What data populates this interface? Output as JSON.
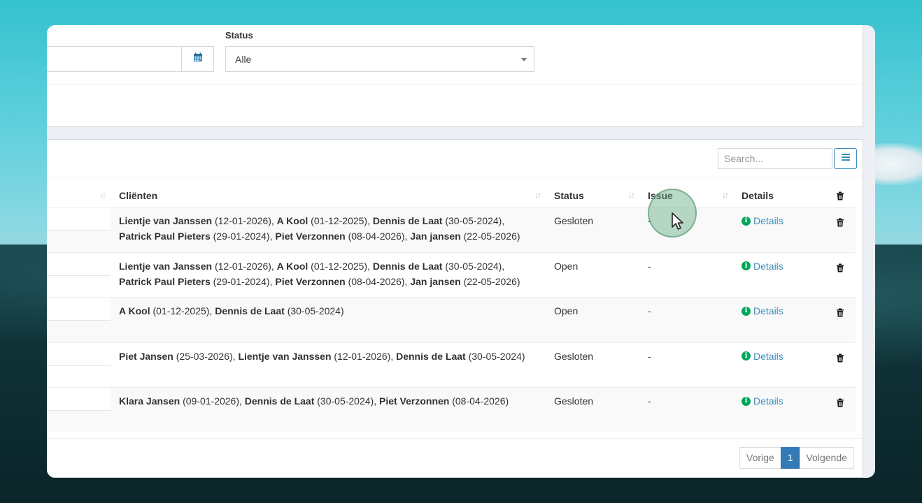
{
  "filter": {
    "status_label": "Status",
    "status_value": "Alle"
  },
  "table": {
    "search_placeholder": "Search...",
    "columns": [
      "Cliënten",
      "Status",
      "Issue",
      "Details"
    ],
    "rows": [
      {
        "clients": [
          {
            "name": "Lientje van Janssen",
            "date": "(12-01-2026)"
          },
          {
            "name": "A Kool",
            "date": "(01-12-2025)"
          },
          {
            "name": "Dennis de Laat",
            "date": "(30-05-2024)"
          },
          {
            "name": "Patrick Paul Pieters",
            "date": "(29-01-2024)"
          },
          {
            "name": "Piet Verzonnen",
            "date": "(08-04-2026)"
          },
          {
            "name": "Jan jansen",
            "date": "(22-05-2026)"
          }
        ],
        "status": "Gesloten",
        "issue": "-",
        "details": "Details"
      },
      {
        "clients": [
          {
            "name": "Lientje van Janssen",
            "date": "(12-01-2026)"
          },
          {
            "name": "A Kool",
            "date": "(01-12-2025)"
          },
          {
            "name": "Dennis de Laat",
            "date": "(30-05-2024)"
          },
          {
            "name": "Patrick Paul Pieters",
            "date": "(29-01-2024)"
          },
          {
            "name": "Piet Verzonnen",
            "date": "(08-04-2026)"
          },
          {
            "name": "Jan jansen",
            "date": "(22-05-2026)"
          }
        ],
        "status": "Open",
        "issue": "-",
        "details": "Details"
      },
      {
        "clients": [
          {
            "name": "A Kool",
            "date": "(01-12-2025)"
          },
          {
            "name": "Dennis de Laat",
            "date": "(30-05-2024)"
          }
        ],
        "status": "Open",
        "issue": "-",
        "details": "Details"
      },
      {
        "clients": [
          {
            "name": "Piet Jansen",
            "date": "(25-03-2026)"
          },
          {
            "name": "Lientje van Janssen",
            "date": "(12-01-2026)"
          },
          {
            "name": "Dennis de Laat",
            "date": "(30-05-2024)"
          }
        ],
        "status": "Gesloten",
        "issue": "-",
        "details": "Details"
      },
      {
        "clients": [
          {
            "name": "Klara Jansen",
            "date": "(09-01-2026)"
          },
          {
            "name": "Dennis de Laat",
            "date": "(30-05-2024)"
          },
          {
            "name": "Piet Verzonnen",
            "date": "(08-04-2026)"
          }
        ],
        "status": "Gesloten",
        "issue": "-",
        "details": "Details"
      }
    ]
  },
  "pagination": {
    "prev": "Vorige",
    "current": "1",
    "next": "Volgende"
  },
  "colors": {
    "accent": "#3c8dbc",
    "info_green": "#00a65a",
    "page_active": "#337ab7"
  }
}
